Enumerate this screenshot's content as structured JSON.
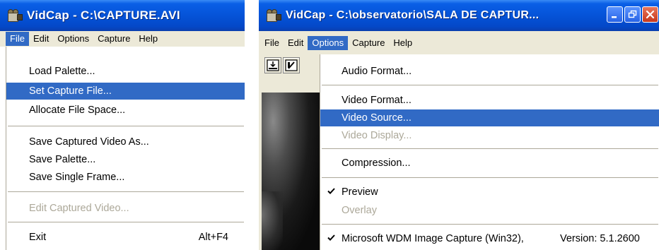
{
  "left_window": {
    "title": "VidCap - C:\\CAPTURE.AVI",
    "menu": [
      "File",
      "Edit",
      "Options",
      "Capture",
      "Help"
    ],
    "active_menu": "File",
    "file_menu": {
      "load_palette": "Load Palette...",
      "set_capture_file": "Set Capture File...",
      "allocate_file_space": "Allocate File Space...",
      "save_captured_video_as": "Save Captured Video As...",
      "save_palette": "Save Palette...",
      "save_single_frame": "Save Single Frame...",
      "edit_captured_video": "Edit Captured Video...",
      "exit": "Exit",
      "exit_shortcut": "Alt+F4"
    }
  },
  "right_window": {
    "title": "VidCap - C:\\observatorio\\SALA DE CAPTUR...",
    "menu": [
      "File",
      "Edit",
      "Options",
      "Capture",
      "Help"
    ],
    "active_menu": "Options",
    "options_menu": {
      "audio_format": "Audio Format...",
      "video_format": "Video Format...",
      "video_source": "Video Source...",
      "video_display": "Video Display...",
      "compression": "Compression...",
      "preview": "Preview",
      "overlay": "Overlay",
      "driver": "Microsoft WDM Image Capture (Win32),",
      "driver_version": "Version:  5.1.2600"
    }
  },
  "colors": {
    "titlebar": "#0553d8",
    "highlight": "#316ac5",
    "menubar": "#ece9d8",
    "disabled_text": "#aca899"
  },
  "icons": [
    "camera-icon",
    "minimize-icon",
    "restore-icon",
    "close-icon",
    "capture-frame-icon",
    "edit-frame-icon",
    "checkmark-icon"
  ]
}
